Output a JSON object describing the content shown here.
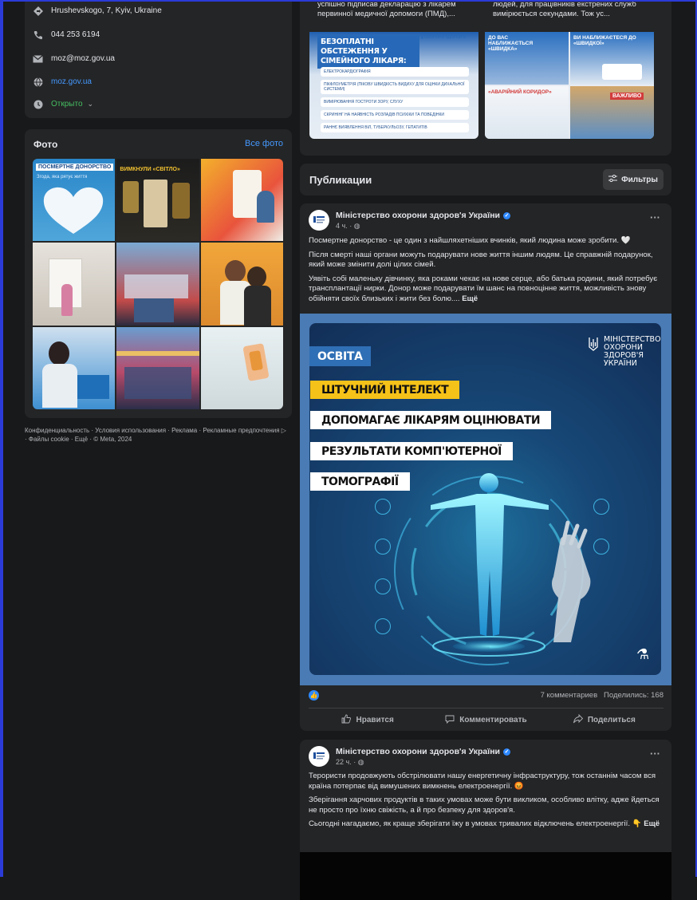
{
  "about": {
    "address": "Hrushevskogo, 7, Kyiv, Ukraine",
    "phone": "044 253 6194",
    "email": "moz@moz.gov.ua",
    "website": "moz.gov.ua",
    "hours": "Открыто",
    "icons": [
      "location-icon",
      "phone-icon",
      "email-icon",
      "globe-icon",
      "clock-icon"
    ]
  },
  "photos": {
    "title": "Фото",
    "see_all": "Все фото",
    "tile1_text": "ПОСМЕРТНЕ ДОНОРСТВО",
    "tile1_sub": "Згода, яка рятує життя",
    "tile2_text": "ВИМКНУЛИ «СВІТЛО»"
  },
  "footer": "Конфиденциальность · Условия использования · Реклама · Рекламные предпочтения ▷ · Файлы cookie · Ещё · © Meta, 2024",
  "top_card": {
    "left_caption": "успішно підписав декларацію з лікарем первинної медичної допомоги (ПМД),...",
    "right_caption": "людей, для працівників екстрених служб вимірюється секундами. Тож ус...",
    "left_headline": "БЕЗОПЛАТНІ ОБСТЕЖЕННЯ У СІМЕЙНОГО ЛІКАРЯ:",
    "left_items": [
      "ЕЛЕКТРОКАРДІОГРАФІЯ",
      "ПІКФЛОУМЕТРІЯ (ПІКОВУ ШВИДКІСТЬ ВИДИХУ ДЛЯ ОЦІНКИ ДИХАЛЬНОЇ СИСТЕМИ)",
      "ВИМІРЮВАННЯ ГОСТРОТИ ЗОРУ, СЛУХУ",
      "СКРИНІНГ НА НАЯВНІСТЬ РОЗЛАДІВ ПСИХІКИ ТА ПОВЕДІНКИ",
      "РАННЄ ВИЯВЛЕННЯ ВІЛ, ТУБЕРКУЛЬОЗУ, ГЕПАТИТІВ"
    ],
    "right_tiles": [
      "ДО ВАС НАБЛИЖАЄТЬСЯ «ШВИДКА»",
      "ВИ НАБЛИЖАЄТЕСЯ ДО «ШВИДКОЇ»",
      "«АВАРІЙНИЙ КОРИДОР»",
      "ВАЖЛИВО"
    ]
  },
  "publications": {
    "title": "Публикации",
    "filters": "Фильтры"
  },
  "post1": {
    "author": "Міністерство охорони здоров'я України",
    "time": "4 ч. · ",
    "p1": "Посмертне донорство - це один з найшляхетніших вчинків, який людина може зробити. 🤍",
    "p2": "Після смерті наші органи можуть подарувати нове життя іншим людям. Це справжній подарунок, який може змінити долі цілих сімей.",
    "p3": "Уявіть собі маленьку дівчинку, яка роками чекає на нове серце, або батька родини, який потребує трансплантації нирки. Донор може подарувати їм шанс на повноцінне життя, можливість знову обійняти своїх близьких і жити без болю....",
    "more": "Ещё",
    "image": {
      "tag": "ОСВІТА",
      "line1": "ШТУЧНИЙ ІНТЕЛЕКТ",
      "line2": "ДОПОМАГАЄ ЛІКАРЯМ ОЦІНЮВАТИ",
      "line3": "РЕЗУЛЬТАТИ КОМП'ЮТЕРНОЇ",
      "line4": "ТОМОГРАФІЇ",
      "logo": "МІНІСТЕРСТВО ОХОРОНИ ЗДОРОВ'Я УКРАЇНИ"
    },
    "comments": "7 комментариев",
    "shares": "Поделились: 168",
    "like": "Нравится",
    "comment": "Комментировать",
    "share": "Поделиться"
  },
  "post2": {
    "author": "Міністерство охорони здоров'я України",
    "time": "22 ч. · ",
    "p1": "Терористи продовжують обстрілювати нашу енергетичну інфраструктуру, тож останнім часом вся країна потерпає від вимушених вимкнень електроенергії. 😡",
    "p2": "Зберігання харчових продуктів в таких умовах може бути викликом, особливо влітку, адже йдеться не просто про їхню свіжість, а й про безпеку для здоров'я.",
    "p3": "Сьогодні нагадаємо, як краще зберігати їжу в умовах тривалих відключень електроенергії. 👇",
    "more": "Ещё"
  },
  "colors": {
    "background": "#18191a",
    "card": "#242526",
    "accent": "#2d88ff",
    "link": "#4599ff",
    "open_status": "#45bd62",
    "frame": "#2b3bd8"
  }
}
